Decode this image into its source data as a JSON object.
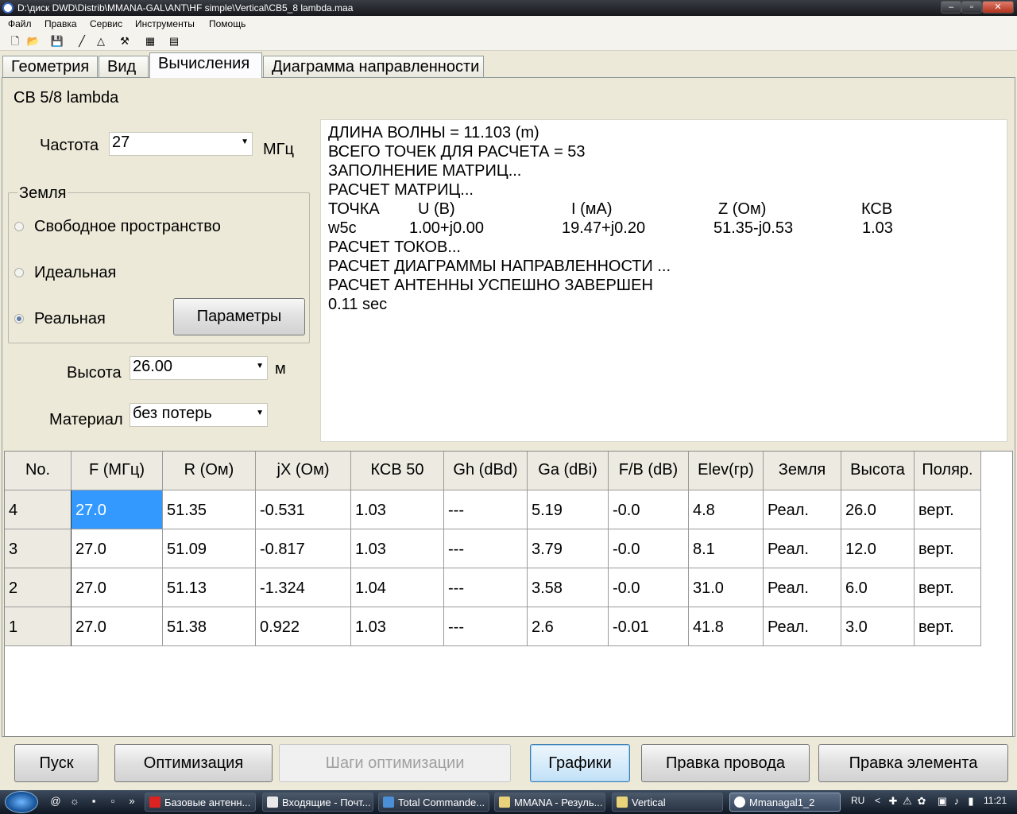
{
  "window": {
    "title": "D:\\диск DWD\\Distrib\\MMANA-GAL\\ANT\\HF simple\\Vertical\\CB5_8 lambda.maa",
    "minimize_glyph": "–",
    "maximize_glyph": "▫",
    "close_glyph": "✕"
  },
  "menu": [
    "Файл",
    "Правка",
    "Сервис",
    "Инструменты",
    "Помощь"
  ],
  "toolbar": {
    "icons": [
      "new-file-icon",
      "open-folder-icon",
      "save-icon",
      "draw-line-icon",
      "triangle-icon",
      "tools-icon",
      "calculator-icon",
      "print-icon"
    ],
    "glyphs": [
      "🗋",
      "📂",
      "💾",
      "╱",
      "△",
      "⚒",
      "▦",
      "▤"
    ]
  },
  "tabs": [
    "Геометрия",
    "Вид",
    "Вычисления",
    "Диаграмма направленности"
  ],
  "active_tab": "Вычисления",
  "project_name": "CB 5/8 lambda",
  "frequency": {
    "label": "Частота",
    "value": "27",
    "unit": "МГц"
  },
  "ground": {
    "title": "Земля",
    "options": [
      "Свободное пространство",
      "Идеальная",
      "Реальная"
    ],
    "selected": "Реальная",
    "params_button": "Параметры"
  },
  "height": {
    "label": "Высота",
    "value": "26.00",
    "unit": "м"
  },
  "material": {
    "label": "Материал",
    "value": "без потерь"
  },
  "dropdown_arrow": "▼",
  "log": {
    "lines_top": [
      "ДЛИНА ВОЛНЫ = 11.103 (m)",
      "ВСЕГО ТОЧЕК ДЛЯ РАСЧЕТА = 53",
      "ЗАПОЛНЕНИЕ МАТРИЦ...",
      "РАСЧЕТ МАТРИЦ..."
    ],
    "table_header": [
      "ТОЧКА",
      "U (В)",
      "I (мА)",
      "Z (Ом)",
      "КСВ"
    ],
    "table_row": [
      "w5c",
      "1.00+j0.00",
      "19.47+j0.20",
      "51.35-j0.53",
      "1.03"
    ],
    "lines_bottom": [
      "РАСЧЕТ ТОКОВ...",
      "РАСЧЕТ ДИАГРАММЫ НАПРАВЛЕННОСТИ ...",
      "РАСЧЕТ АНТЕННЫ УСПЕШНО ЗАВЕРШЕН",
      "0.11 sec"
    ]
  },
  "results_table": {
    "columns": [
      "No.",
      "F (МГц)",
      "R (Ом)",
      "jX (Ом)",
      "КСВ 50",
      "Gh (dBd)",
      "Ga (dBi)",
      "F/B (dB)",
      "Elev(гр)",
      "Земля",
      "Высота",
      "Поляр."
    ],
    "rows": [
      [
        "4",
        "27.0",
        "51.35",
        "-0.531",
        "1.03",
        "---",
        "5.19",
        "-0.0",
        "4.8",
        "Реал.",
        "26.0",
        "верт."
      ],
      [
        "3",
        "27.0",
        "51.09",
        "-0.817",
        "1.03",
        "---",
        "3.79",
        "-0.0",
        "8.1",
        "Реал.",
        "12.0",
        "верт."
      ],
      [
        "2",
        "27.0",
        "51.13",
        "-1.324",
        "1.04",
        "---",
        "3.58",
        "-0.0",
        "31.0",
        "Реал.",
        "6.0",
        "верт."
      ],
      [
        "1",
        "27.0",
        "51.38",
        "0.922",
        "1.03",
        "---",
        "2.6",
        "-0.01",
        "41.8",
        "Реал.",
        "3.0",
        "верт."
      ]
    ],
    "selected_cell": {
      "row": 0,
      "col": 1
    }
  },
  "buttons": {
    "start": "Пуск",
    "optimize": "Оптимизация",
    "opt_steps": "Шаги оптимизации",
    "plots": "Графики",
    "edit_wire": "Правка провода",
    "edit_element": "Правка элемента"
  },
  "taskbar": {
    "quick_launch_more": "»",
    "tasks": [
      "Базовые антенн...",
      "Входящие - Почт...",
      "Total Commande...",
      "MMANA - Резуль...",
      "Vertical",
      "Mmanagal1_2"
    ],
    "active_task": "Mmanagal1_2",
    "tray_nav_left": "<",
    "lang": "RU",
    "clock": "11:21"
  },
  "colors": {
    "selection": "#3399ff",
    "window_bg": "#ece9d8",
    "taskbar": "#1c2535"
  }
}
